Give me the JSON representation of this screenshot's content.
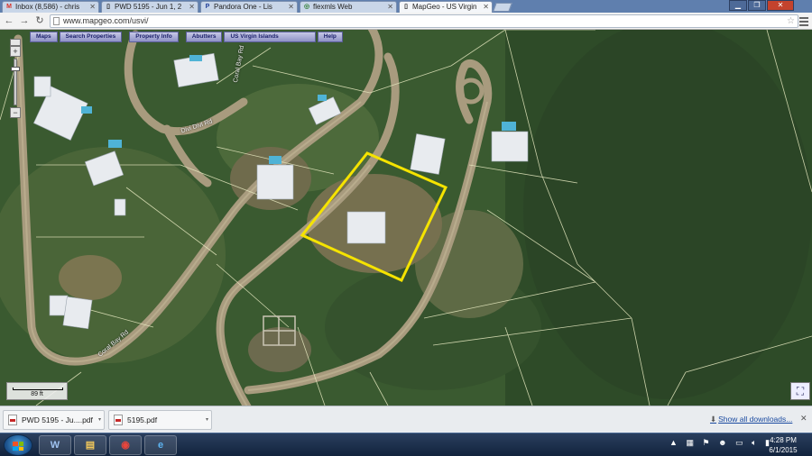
{
  "browser": {
    "tabs": [
      {
        "label": "Inbox (8,586) - chris",
        "favicon": "gmail-icon"
      },
      {
        "label": "PWD 5195 - Jun 1, 2",
        "favicon": "document-icon"
      },
      {
        "label": "Pandora One - Lis",
        "favicon": "pandora-icon"
      },
      {
        "label": "flexmls Web",
        "favicon": "flexmls-icon"
      },
      {
        "label": "MapGeo - US Virgin",
        "favicon": "document-icon"
      }
    ],
    "url": "www.mapgeo.com/usvi/",
    "window_buttons": {
      "minimize": "▁",
      "maximize": "❐",
      "close": "✕"
    }
  },
  "map": {
    "menu": [
      "Maps",
      "Search Properties",
      "Property Info",
      "Abutters",
      "US Virgin Islands",
      "Help"
    ],
    "zoom": {
      "in": "+",
      "out": "−"
    },
    "scale_label": "89 ft",
    "road_labels": [
      "Coral Bay Rd",
      "Coral Bay Rd",
      "Divi Divi Rd"
    ],
    "selection_color": "#f5e300"
  },
  "downloads": {
    "items": [
      {
        "name": "PWD 5195 - Ju....pdf"
      },
      {
        "name": "5195.pdf"
      }
    ],
    "show_all": "Show all downloads...",
    "close": "✕"
  },
  "taskbar": {
    "apps": [
      {
        "name": "word-icon",
        "glyph": "W",
        "color": "#2b579a"
      },
      {
        "name": "explorer-folder-icon",
        "glyph": "▤",
        "color": "#d9a93a"
      },
      {
        "name": "chrome-icon",
        "glyph": "◉",
        "color": "#3aa55d"
      },
      {
        "name": "ie-icon",
        "glyph": "e",
        "color": "#3a86d6"
      }
    ],
    "clock_time": "4:28 PM",
    "clock_date": "6/1/2015"
  }
}
